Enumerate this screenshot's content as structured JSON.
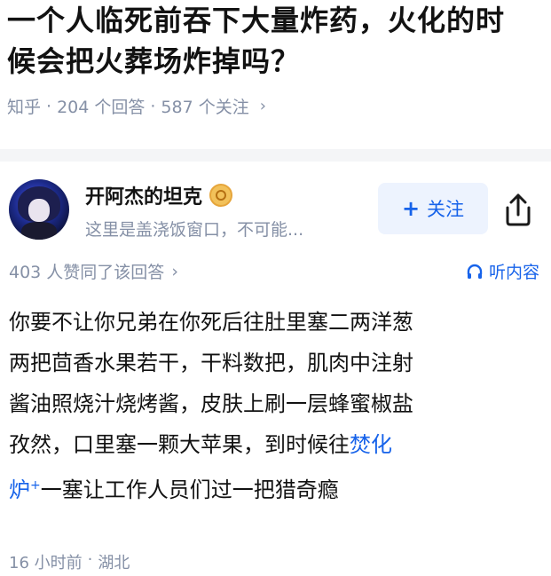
{
  "question": {
    "title_line1": "一个人临死前吞下大量炸药，火化的时",
    "title_line2": "候会把火葬场炸掉吗？",
    "source": "知乎",
    "answers_count": "204 个回答",
    "followers_count": "587 个关注",
    "separator": "·",
    "chevron": "›"
  },
  "author": {
    "name": "开阿杰的坦克",
    "bio": "这里是盖浇饭窗口，不可能...",
    "badge_icon": "badge-icon",
    "follow_label": "关注",
    "follow_plus": "+",
    "share_icon": "share-icon"
  },
  "votes": {
    "text": "403 人赞同了该回答",
    "chevron": "›",
    "listen_icon": "headphones-icon",
    "listen_label": "听内容"
  },
  "answer": {
    "line1": "你要不让你兄弟在你死后往肚里塞二两洋葱",
    "line2": "两把茴香水果若干，干料数把，肌肉中注射",
    "line3": "酱油照烧汁烧烤酱，皮肤上刷一层蜂蜜椒盐",
    "line4_pre": "孜然，口里塞一颗大苹果，到时候往",
    "line4_kw": "焚化",
    "line5_kw": "炉",
    "line5_mark": "+",
    "line5_post": "一塞让工作人员们过一把猎奇瘾"
  },
  "footer": {
    "time": "16 小时前",
    "separator": "·",
    "location": "湖北"
  },
  "colors": {
    "accent": "#1763ea",
    "meta": "#8590a6",
    "text": "#121212"
  }
}
